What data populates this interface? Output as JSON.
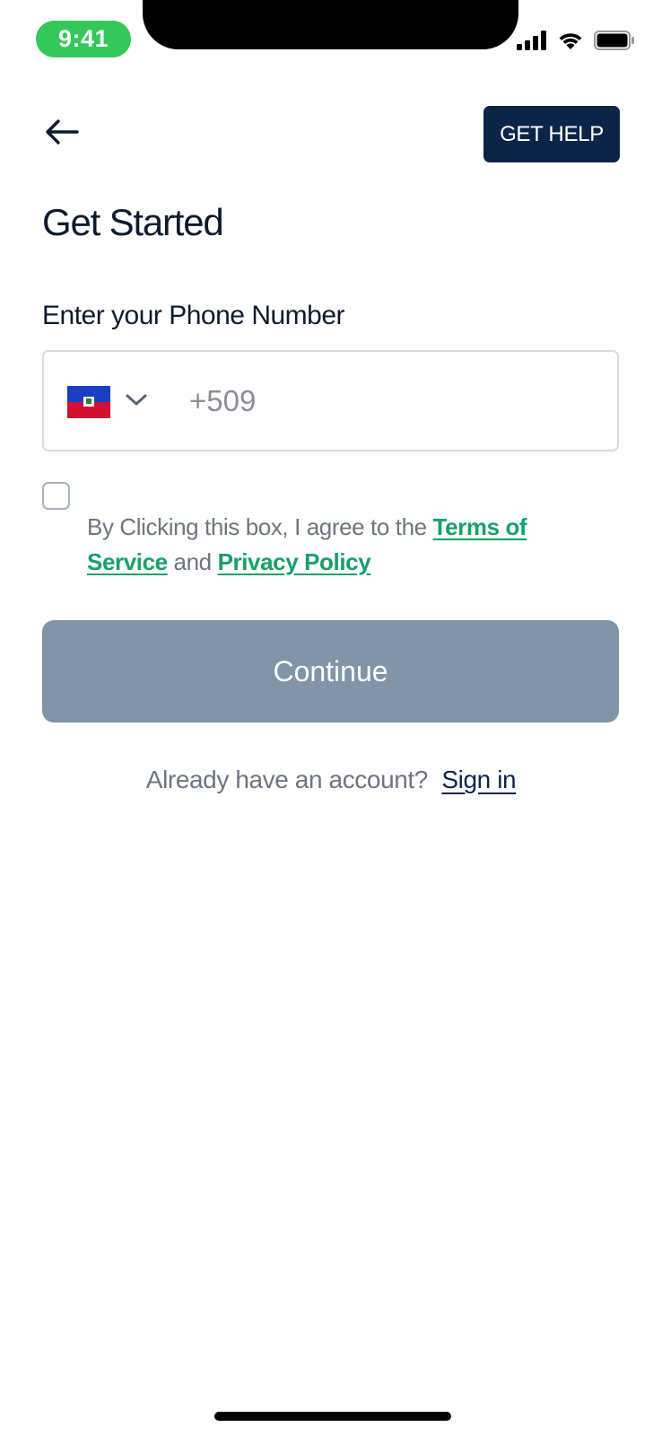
{
  "status_bar": {
    "time": "9:41",
    "icons": [
      "cellular-signal-icon",
      "wifi-icon",
      "battery-icon"
    ]
  },
  "header": {
    "back_icon": "arrow-left-icon",
    "help_label": "GET HELP"
  },
  "page": {
    "title": "Get Started"
  },
  "phone": {
    "label": "Enter your Phone Number",
    "country_flag": "haiti-flag-icon",
    "dropdown_icon": "chevron-down-icon",
    "placeholder": "+509",
    "value": ""
  },
  "terms": {
    "checked": false,
    "prefix": "By Clicking this box, I agree to the ",
    "terms_link": "Terms of Service",
    "connector": " and ",
    "privacy_link": "Privacy Policy"
  },
  "continue": {
    "label": "Continue",
    "enabled": false
  },
  "signin": {
    "prompt": "Already have an account?",
    "link": "Sign in"
  },
  "colors": {
    "primary_navy": "#0b2549",
    "link_green": "#17a06a",
    "disabled_button": "#8194a8",
    "time_pill": "#34c759"
  }
}
